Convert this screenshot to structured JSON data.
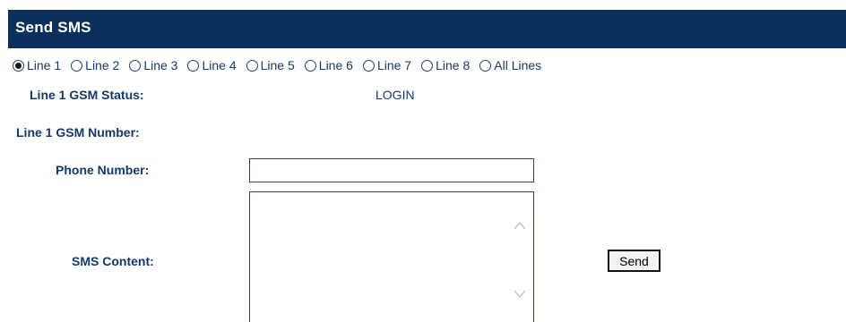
{
  "header": {
    "title": "Send SMS"
  },
  "lines": [
    {
      "label": "Line 1",
      "checked": true
    },
    {
      "label": "Line 2",
      "checked": false
    },
    {
      "label": "Line 3",
      "checked": false
    },
    {
      "label": "Line 4",
      "checked": false
    },
    {
      "label": "Line 5",
      "checked": false
    },
    {
      "label": "Line 6",
      "checked": false
    },
    {
      "label": "Line 7",
      "checked": false
    },
    {
      "label": "Line 8",
      "checked": false
    },
    {
      "label": "All Lines",
      "checked": false
    }
  ],
  "status": {
    "gsm_status_label": "Line 1 GSM Status:",
    "gsm_status_value": "LOGIN",
    "gsm_number_label": "Line 1 GSM Number:",
    "gsm_number_value": ""
  },
  "form": {
    "phone_label": "Phone Number:",
    "phone_value": "",
    "sms_label": "SMS Content:",
    "sms_value": "",
    "send_label": "Send"
  },
  "icons": {
    "scroll_up": "chevron-up-icon",
    "scroll_down": "chevron-down-icon"
  },
  "colors": {
    "header_bg": "#0b2f5c",
    "text": "#14396b"
  }
}
